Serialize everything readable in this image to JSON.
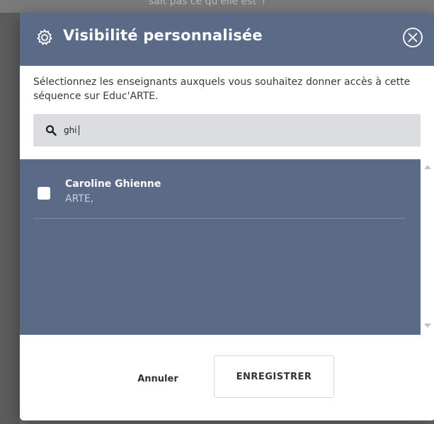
{
  "background": {
    "partial_text": "sait pas ce qu'elle est\"?"
  },
  "modal": {
    "title": "Visibilité personnalisée",
    "description": "Sélectionnez les enseignants auxquels vous souhaitez donner accès à cette séquence sur Educ'ARTE.",
    "search": {
      "value": "ghi",
      "placeholder": ""
    },
    "results": [
      {
        "name": "Caroline Ghienne",
        "organization": "ARTE,",
        "checked": false
      }
    ],
    "footer": {
      "cancel_label": "Annuler",
      "save_label": "ENREGISTRER"
    }
  },
  "colors": {
    "header_bg": "#5b6a87",
    "results_bg": "#5b6a87",
    "search_bg": "#dcdde0",
    "title_text": "#ffffff"
  },
  "icons": {
    "header": "gear-icon",
    "close": "close-circle-icon",
    "search": "search-icon"
  }
}
